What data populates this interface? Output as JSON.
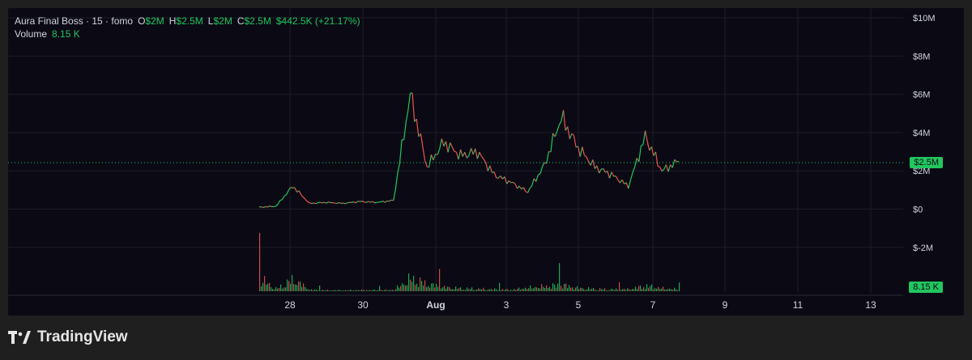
{
  "legend": {
    "symbol": "Aura Final Boss · 15 · fomo",
    "open_label": "O",
    "open_value": "$2M",
    "high_label": "H",
    "high_value": "$2.5M",
    "low_label": "L",
    "low_value": "$2M",
    "close_label": "C",
    "close_value": "$2.5M",
    "change": "$442.5K (+21.17%)",
    "volume_label": "Volume",
    "volume_value": "8.15 K"
  },
  "price_axis": {
    "ticks": [
      "$10M",
      "$8M",
      "$6M",
      "$4M",
      "$2M",
      "$0",
      "$-2M"
    ]
  },
  "badges": {
    "price": "$2.5M",
    "volume": "8.15 K"
  },
  "time_axis": {
    "ticks": [
      "28",
      "30",
      "Aug",
      "3",
      "5",
      "7",
      "9",
      "11",
      "13"
    ]
  },
  "brand": {
    "name": "TradingView"
  },
  "colors": {
    "background": "#0b0a14",
    "up": "#22c55e",
    "down": "#ef5350",
    "grid": "#1d1c27"
  },
  "chart_data": {
    "type": "line",
    "ylim": [
      -2000000,
      10000000
    ],
    "x": [
      "Jul 27",
      "Jul 27 12h",
      "Jul 28",
      "Jul 28 6h",
      "Jul 29",
      "Jul 30",
      "Jul 31",
      "Aug 1",
      "Aug 2",
      "Aug 2 18h",
      "Aug 2 20h",
      "Aug 3",
      "Aug 3 8h",
      "Aug 3 16h",
      "Aug 4",
      "Aug 4 12h",
      "Aug 5",
      "Aug 5 6h",
      "Aug 5 12h",
      "Aug 5 18h",
      "Aug 6",
      "Aug 6 12h",
      "Aug 7",
      "Aug 7 6h",
      "Aug 7 12h",
      "Aug 7 18h"
    ],
    "series": [
      {
        "values": [
          100000,
          150000,
          1200000,
          300000,
          350000,
          300000,
          400000,
          350000,
          450000,
          6000000,
          2200000,
          3500000,
          2800000,
          3000000,
          1800000,
          1400000,
          900000,
          2300000,
          4800000,
          3200000,
          2200000,
          1800000,
          1200000,
          3800000,
          2000000,
          2500000
        ]
      }
    ],
    "volume": [
      8000,
      1500,
      7500,
      900,
      700,
      600,
      800,
      700,
      900,
      8000,
      4500,
      2500,
      1800,
      1500,
      1200,
      1000,
      2200,
      3000,
      4000,
      2000,
      1500,
      1200,
      1300,
      3500,
      1800,
      1200
    ]
  }
}
